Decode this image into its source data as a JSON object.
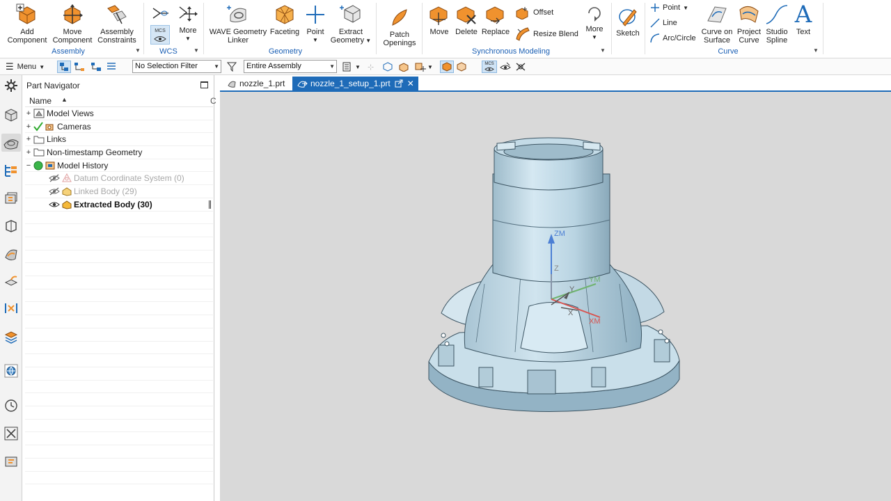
{
  "ribbon": {
    "assembly": {
      "label": "Assembly",
      "add_component": "Add Component",
      "move_component": "Move Component",
      "assembly_constraints": "Assembly Constraints"
    },
    "wcs": {
      "label": "WCS",
      "more": "More",
      "mcs_badge": "MCS"
    },
    "geometry": {
      "label": "Geometry",
      "wave_linker": "WAVE Geometry Linker",
      "faceting": "Faceting",
      "point": "Point",
      "extract_geometry": "Extract Geometry"
    },
    "patch_openings": "Patch Openings",
    "synchronous": {
      "label": "Synchronous Modeling",
      "move": "Move",
      "delete": "Delete",
      "replace": "Replace",
      "offset": "Offset",
      "resize_blend": "Resize Blend",
      "more": "More"
    },
    "sketch": "Sketch",
    "curve": {
      "label": "Curve",
      "point": "Point",
      "line": "Line",
      "arc_circle": "Arc/Circle",
      "curve_on_surface": "Curve on Surface",
      "project_curve": "Project Curve",
      "studio_spline": "Studio Spline",
      "text": "Text"
    }
  },
  "toolbar": {
    "menu": "Menu",
    "selection_filter": "No Selection Filter",
    "scope": "Entire Assembly",
    "mcs_badge": "MCS"
  },
  "navigator": {
    "title": "Part Navigator",
    "column_name": "Name",
    "column_trunc": "C",
    "items": [
      {
        "label": "Model Views",
        "expander": "+"
      },
      {
        "label": "Cameras",
        "expander": "+"
      },
      {
        "label": "Links",
        "expander": "+"
      },
      {
        "label": "Non-timestamp Geometry",
        "expander": "+"
      },
      {
        "label": "Model History",
        "expander": "−"
      },
      {
        "label": "Datum Coordinate System (0)"
      },
      {
        "label": "Linked Body (29)"
      },
      {
        "label": "Extracted Body (30)"
      }
    ]
  },
  "tabs": [
    {
      "label": "nozzle_1.prt"
    },
    {
      "label": "nozzle_1_setup_1.prt",
      "close": "✕"
    }
  ],
  "viewport": {
    "axis_zm": "ZM",
    "axis_z": "Z",
    "axis_ym": "YM",
    "axis_y": "Y",
    "axis_xm": "XM",
    "axis_x": "X"
  },
  "colors": {
    "accent": "#1e6bb8",
    "orange": "#f0922e",
    "viewport_bg": "#d9d9d9",
    "part": "#b9d4e2"
  }
}
